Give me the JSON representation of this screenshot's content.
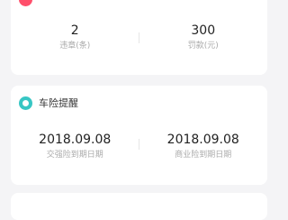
{
  "violations": {
    "count_value": "2",
    "count_label": "违章(条)",
    "fine_value": "300",
    "fine_label": "罚款(元)"
  },
  "insurance": {
    "title": "车险提醒",
    "compulsory_date": "2018.09.08",
    "compulsory_label": "交强险到期日期",
    "commercial_date": "2018.09.08",
    "commercial_label": "商业险到期日期"
  },
  "colors": {
    "violation_icon": "#ff4f6b",
    "insurance_icon": "#37c6c4"
  },
  "icons": {
    "violation": "traffic-violation-icon",
    "insurance": "insurance-reminder-icon"
  }
}
